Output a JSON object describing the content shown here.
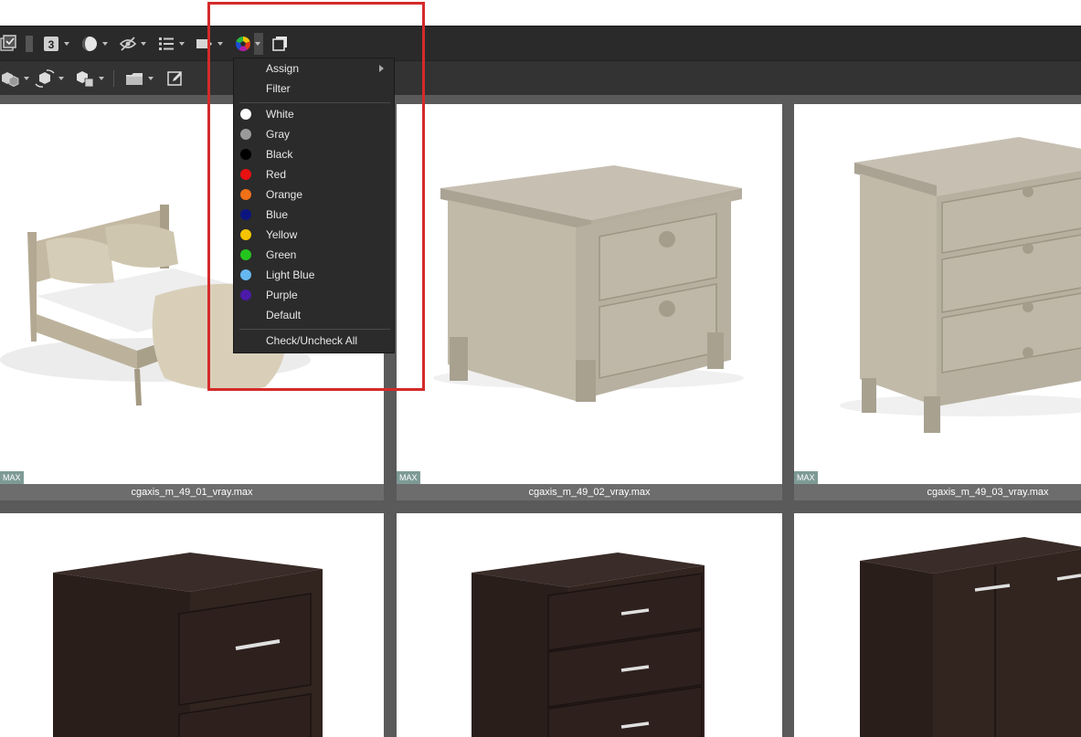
{
  "menu": {
    "assign": "Assign",
    "filter": "Filter",
    "colors": [
      {
        "label": "White",
        "color": "#ffffff"
      },
      {
        "label": "Gray",
        "color": "#9a9a9a"
      },
      {
        "label": "Black",
        "color": "#000000"
      },
      {
        "label": "Red",
        "color": "#e81010"
      },
      {
        "label": "Orange",
        "color": "#f07018"
      },
      {
        "label": "Blue",
        "color": "#0c1480"
      },
      {
        "label": "Yellow",
        "color": "#f5c400"
      },
      {
        "label": "Green",
        "color": "#24c61e"
      },
      {
        "label": "Light Blue",
        "color": "#66b8f0"
      },
      {
        "label": "Purple",
        "color": "#4b1aa8"
      }
    ],
    "default": "Default",
    "check_all": "Check/Uncheck All"
  },
  "thumbnails": [
    {
      "name": "cgaxis_m_49_01_vray.max",
      "badge": "MAX"
    },
    {
      "name": "cgaxis_m_49_02_vray.max",
      "badge": "MAX"
    },
    {
      "name": "cgaxis_m_49_03_vray.max",
      "badge": "MAX"
    }
  ],
  "toolbar": {
    "icons": [
      "checklist-icon",
      "number-badge-icon",
      "shading-icon",
      "hide-icon",
      "list-view-icon",
      "label-icon",
      "color-wheel-icon",
      "copy-icon"
    ],
    "number_badge": "3"
  }
}
